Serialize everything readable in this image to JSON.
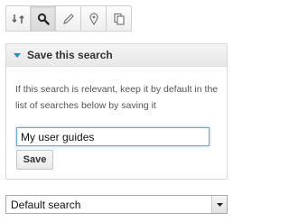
{
  "toolbar": {
    "tools": [
      {
        "icon": "move-icon",
        "active": false
      },
      {
        "icon": "search-icon",
        "active": true
      },
      {
        "icon": "pencil-icon",
        "active": false
      },
      {
        "icon": "map-pin-icon",
        "active": false
      },
      {
        "icon": "copy-icon",
        "active": false
      }
    ]
  },
  "save_panel": {
    "title": "Save this search",
    "description": "If this search is relevant, keep it by default in the list of searches below by saving it",
    "input_value": "My user guides",
    "save_label": "Save"
  },
  "search_select": {
    "selected": "Default search"
  },
  "colors": {
    "accent": "#2a8bd0",
    "input_focus": "#6aa6e0"
  }
}
